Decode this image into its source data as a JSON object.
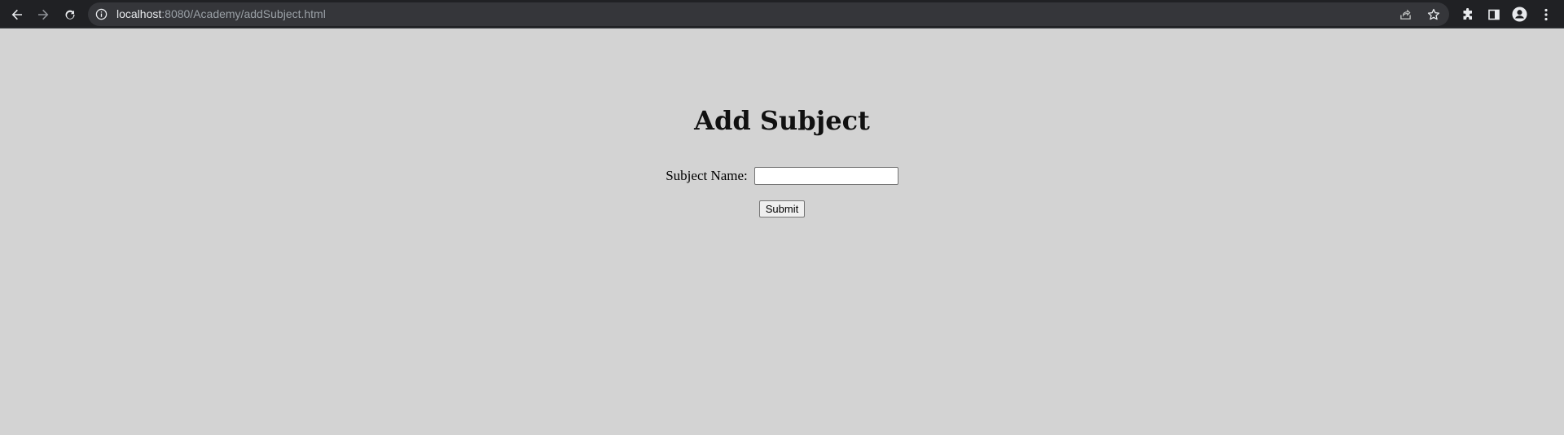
{
  "browser": {
    "url_host": "localhost",
    "url_rest": ":8080/Academy/addSubject.html"
  },
  "page": {
    "title": "Add Subject",
    "form": {
      "subject_name_label": "Subject Name:",
      "subject_name_value": "",
      "submit_label": "Submit"
    }
  },
  "colors": {
    "page_background": "#d3d3d3",
    "toolbar_background": "#202124",
    "omnibox_background": "#35363a"
  },
  "icons": {
    "back": "back-arrow-icon",
    "forward": "forward-arrow-icon",
    "reload": "reload-icon",
    "site_info": "info-icon",
    "share": "share-icon",
    "bookmark": "star-icon",
    "extensions": "puzzle-icon",
    "side_panel": "side-panel-icon",
    "profile": "profile-icon",
    "menu": "kebab-menu-icon"
  }
}
